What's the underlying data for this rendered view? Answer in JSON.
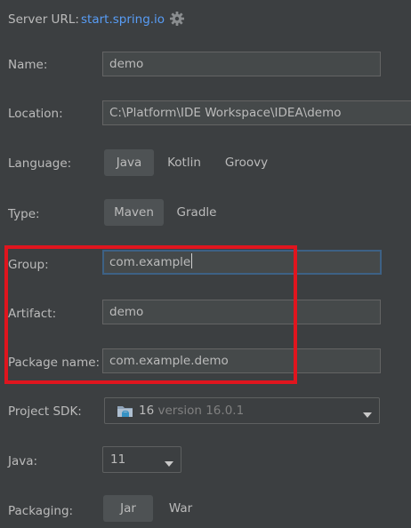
{
  "server": {
    "label": "Server URL:",
    "url": "start.spring.io",
    "settings_icon": "gear-icon"
  },
  "name": {
    "label": "Name:",
    "value": "demo"
  },
  "location": {
    "label": "Location:",
    "value": "C:\\Platform\\IDE Workspace\\IDEA\\demo"
  },
  "language": {
    "label": "Language:",
    "options": [
      "Java",
      "Kotlin",
      "Groovy"
    ],
    "selected": "Java"
  },
  "type": {
    "label": "Type:",
    "options": [
      "Maven",
      "Gradle"
    ],
    "selected": "Maven"
  },
  "group": {
    "label": "Group:",
    "value": "com.example"
  },
  "artifact": {
    "label": "Artifact:",
    "value": "demo"
  },
  "package_name": {
    "label": "Package name:",
    "value": "com.example.demo"
  },
  "project_sdk": {
    "label": "Project SDK:",
    "version_major": "16",
    "version_detail": "version 16.0.1",
    "icon": "folder-icon"
  },
  "java": {
    "label": "Java:",
    "value": "11"
  },
  "packaging": {
    "label": "Packaging:",
    "options": [
      "Jar",
      "War"
    ],
    "selected": "Jar"
  },
  "colors": {
    "background": "#3c3f41",
    "link": "#589df6",
    "highlight_box": "#e0151e",
    "focus_border": "#3d6185"
  }
}
